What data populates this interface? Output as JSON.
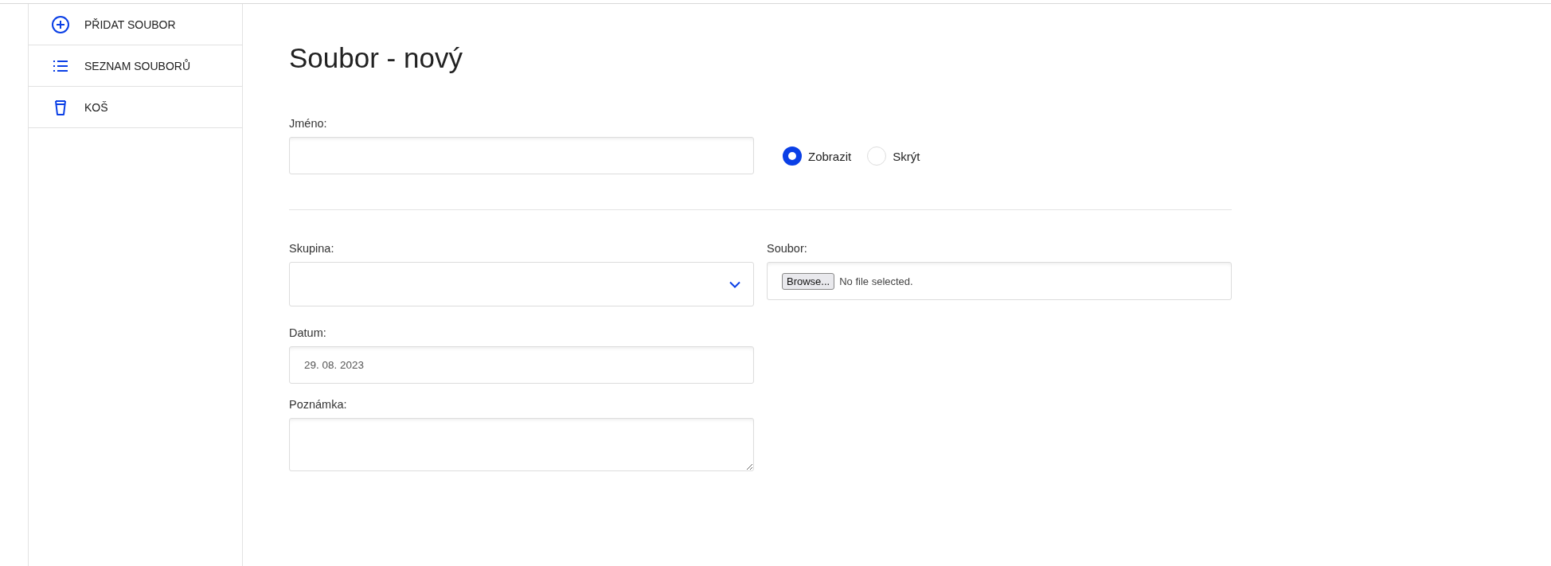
{
  "sidebar": {
    "items": [
      {
        "label": "PŘIDAT SOUBOR",
        "kind": "add",
        "selected": false
      },
      {
        "label": "SEZNAM SOUBORŮ",
        "kind": "list",
        "selected": false
      },
      {
        "label": "KOŠ",
        "kind": "trash",
        "selected": false
      }
    ]
  },
  "page_title": "Soubor - nový",
  "form": {
    "name": {
      "label": "Jméno:"
    },
    "visibility": [
      {
        "label": "Zobrazit",
        "selected": true
      },
      {
        "label": "Skrýt",
        "selected": false
      }
    ],
    "group": {
      "label": "Skupina:"
    },
    "file": {
      "label": "Soubor:",
      "button": "Browse...",
      "status": "No file selected."
    },
    "date": {
      "label": "Datum:",
      "value": "29. 08. 2023"
    },
    "note": {
      "label": "Poznámka:"
    }
  }
}
